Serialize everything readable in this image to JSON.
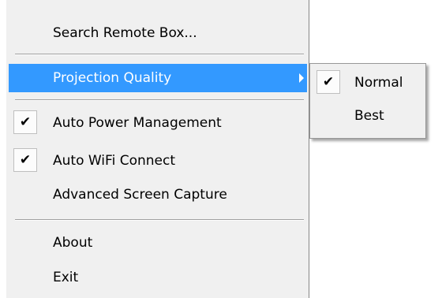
{
  "menu": {
    "items": [
      {
        "label": "Search Remote Box..."
      },
      {
        "label": "Projection Quality"
      },
      {
        "label": "Auto Power Management",
        "checked": true
      },
      {
        "label": "Auto WiFi Connect",
        "checked": true
      },
      {
        "label": "Advanced Screen Capture"
      },
      {
        "label": "About"
      },
      {
        "label": "Exit"
      }
    ],
    "check_glyph": "✔"
  },
  "submenu": {
    "items": [
      {
        "label": "Normal",
        "checked": true
      },
      {
        "label": "Best"
      }
    ]
  },
  "colors": {
    "highlight": "#3399ff",
    "menu_background": "#f0f0f0"
  }
}
